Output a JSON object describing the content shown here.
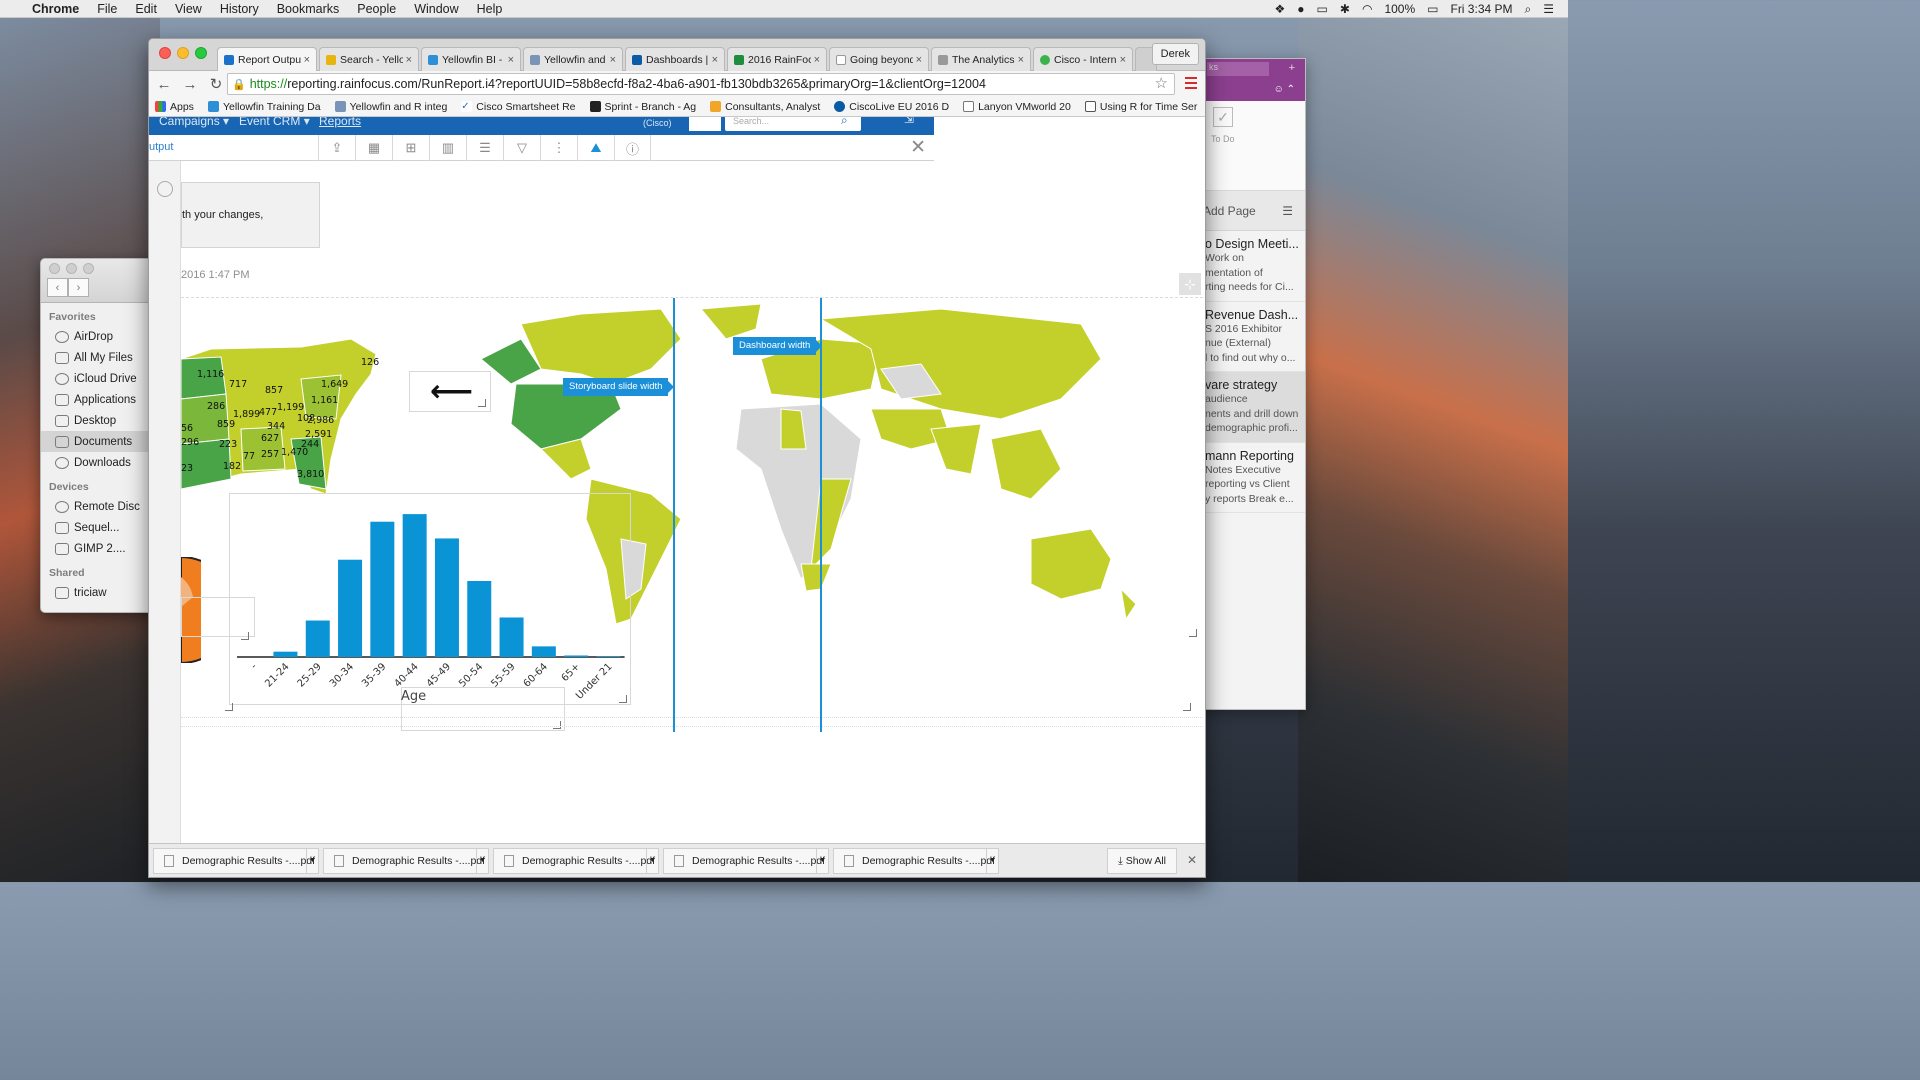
{
  "menubar": {
    "app": "Chrome",
    "items": [
      "File",
      "Edit",
      "View",
      "History",
      "Bookmarks",
      "People",
      "Window",
      "Help"
    ],
    "battery": "100%",
    "clock": "Fri 3:34 PM"
  },
  "finder": {
    "favorites_label": "Favorites",
    "favorites": [
      "AirDrop",
      "All My Files",
      "iCloud Drive",
      "Applications",
      "Desktop",
      "Documents",
      "Downloads"
    ],
    "devices_label": "Devices",
    "devices": [
      "Remote Disc",
      "Sequel...",
      "GIMP 2...."
    ],
    "shared_label": "Shared",
    "shared": [
      "triciaw"
    ]
  },
  "onenote": {
    "purple_bar_text": "ks",
    "todo_label": "To Do",
    "add_page": "Add Page",
    "pages": [
      {
        "title": "o Design Meeti...",
        "lines": [
          "Work on",
          "mentation of",
          "rting needs for Ci..."
        ]
      },
      {
        "title": "Revenue Dash...",
        "lines": [
          "S 2016 Exhibitor",
          "nue (External)",
          "l to find out why o..."
        ]
      },
      {
        "title": "vare strategy",
        "lines": [
          "audience",
          "nents and drill down",
          "demographic profi..."
        ]
      },
      {
        "title": "mann Reporting",
        "lines": [
          "Notes  Executive",
          "reporting vs  Client",
          "y reports  Break e..."
        ]
      }
    ]
  },
  "browser": {
    "profile": "Derek",
    "tabs": [
      "Report Outpu",
      "Search - Yello",
      "Yellowfin BI -",
      "Yellowfin and",
      "Dashboards |",
      "2016 RainFoc",
      "Going beyond",
      "The Analytics",
      "Cisco - Intern"
    ],
    "url_scheme": "https://",
    "url_rest": "reporting.rainfocus.com/RunReport.i4?reportUUID=58b8ecfd-f8a2-4ba6-a901-fb130bdb3265&primaryOrg=1&clientOrg=12004",
    "bookmarks": [
      "Apps",
      "Yellowfin Training Da",
      "Yellowfin and R integ",
      "Cisco Smartsheet Re",
      "Sprint - Branch - Ag",
      "Consultants, Analyst",
      "CiscoLive EU 2016 D",
      "Lanyon VMworld 20",
      "Using R for Time Ser"
    ]
  },
  "app": {
    "nav": [
      "Campaigns",
      "Event CRM",
      "Reports"
    ],
    "org": "(Cisco)",
    "search_placeholder": "Search...",
    "crumb": "utput",
    "notice": "th your changes,",
    "timestamp": "2016 1:47 PM",
    "guide_storyboard": "Storyboard slide width",
    "guide_dashboard": "Dashboard width",
    "arrow_glyph": "⟵"
  },
  "us_map_labels": [
    "1,116",
    "717",
    "857",
    "1,649",
    "126",
    "286",
    "1,899",
    "477",
    "1,199",
    "1,161",
    "56",
    "859",
    "344",
    "108",
    "2,986",
    "296",
    "223",
    "627",
    "2,591",
    "77",
    "257",
    "1,470",
    "244",
    "23",
    "182",
    "3,810"
  ],
  "chart_data": {
    "type": "bar",
    "categories": [
      "-",
      "21-24",
      "25-29",
      "30-34",
      "35-39",
      "40-44",
      "45-49",
      "50-54",
      "55-59",
      "60-64",
      "65+",
      "Under 21"
    ],
    "values": [
      0,
      3.5,
      24,
      64,
      89,
      94,
      78,
      50,
      26,
      7,
      1,
      0.5
    ],
    "xlabel": "Age",
    "ylabel": "",
    "ylim": [
      0,
      100
    ],
    "grid": false,
    "color": "#0a94d6"
  },
  "downloads": {
    "items": [
      "Demographic Results -....pdf",
      "Demographic Results -....pdf",
      "Demographic Results -....pdf",
      "Demographic Results -....pdf",
      "Demographic Results -....pdf"
    ],
    "show_all": "Show All"
  },
  "colors": {
    "map_lime": "#c3d02b",
    "map_green": "#48a447",
    "map_grey": "#d9d9d9",
    "guide_blue": "#1b8fd8",
    "nav_blue": "#1866b3"
  }
}
